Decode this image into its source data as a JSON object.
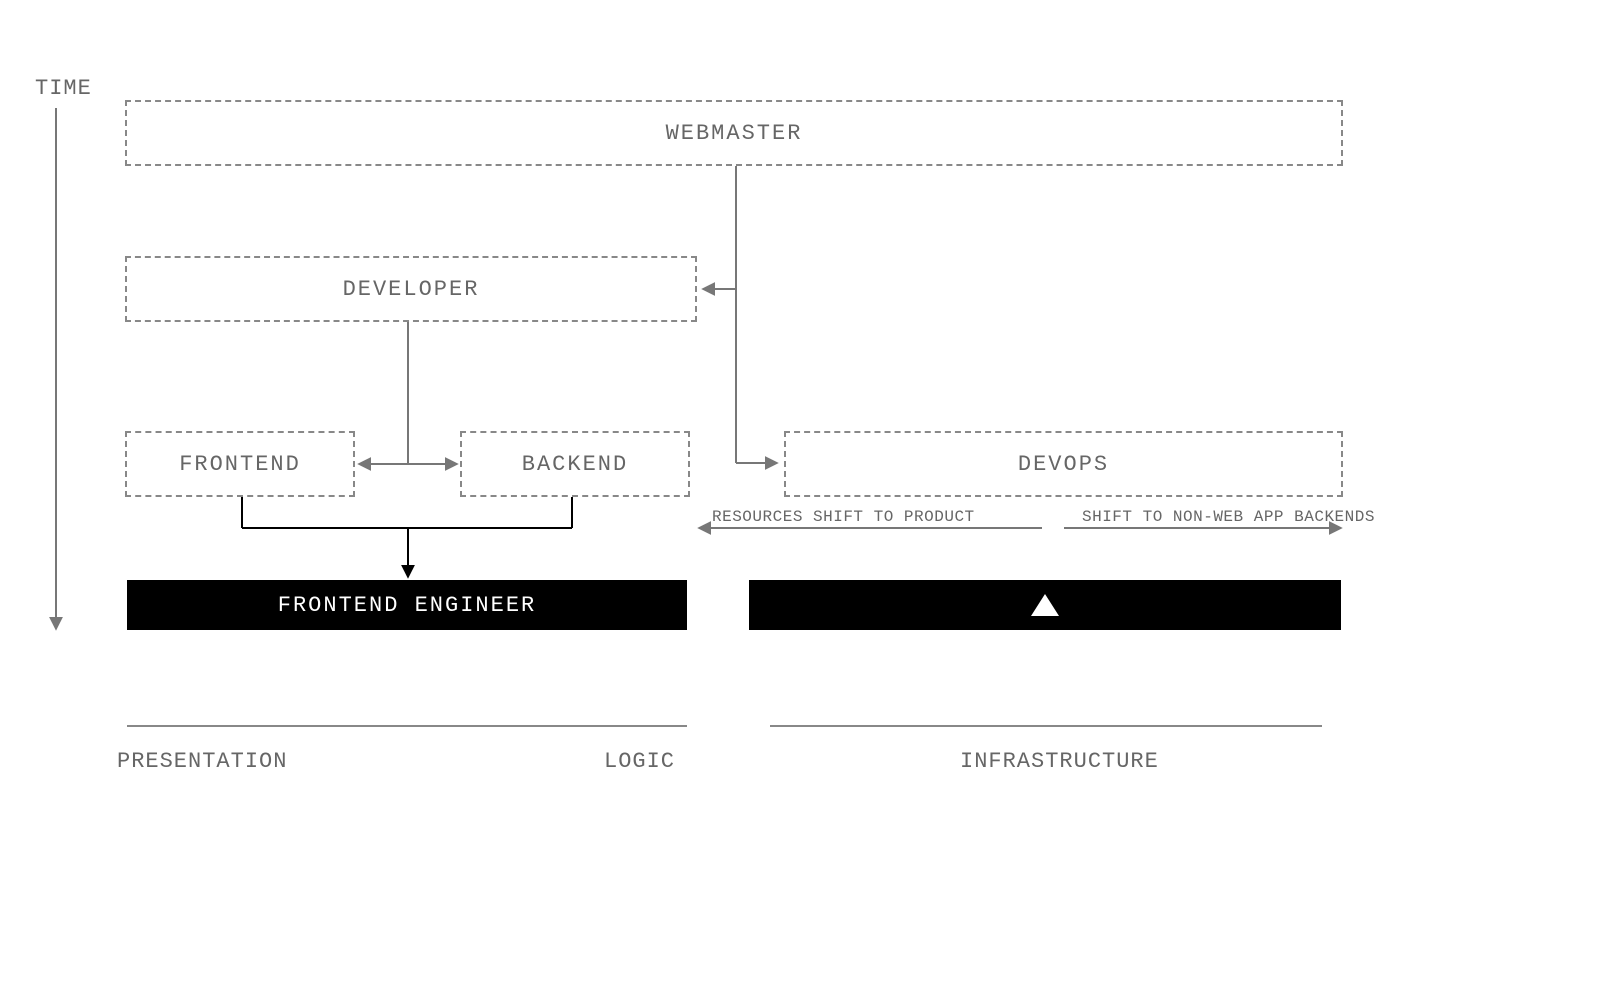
{
  "axis": {
    "time": "TIME"
  },
  "categories": {
    "presentation": "PRESENTATION",
    "logic": "LOGIC",
    "infrastructure": "INFRASTRUCTURE"
  },
  "roles": {
    "webmaster": "WEBMASTER",
    "developer": "DEVELOPER",
    "frontend": "FRONTEND",
    "backend": "BACKEND",
    "devops": "DEVOPS",
    "frontend_engineer": "FRONTEND ENGINEER"
  },
  "annotations": {
    "shift_product": "RESOURCES SHIFT TO PRODUCT",
    "shift_backends": "SHIFT TO NON-WEB APP BACKENDS"
  }
}
